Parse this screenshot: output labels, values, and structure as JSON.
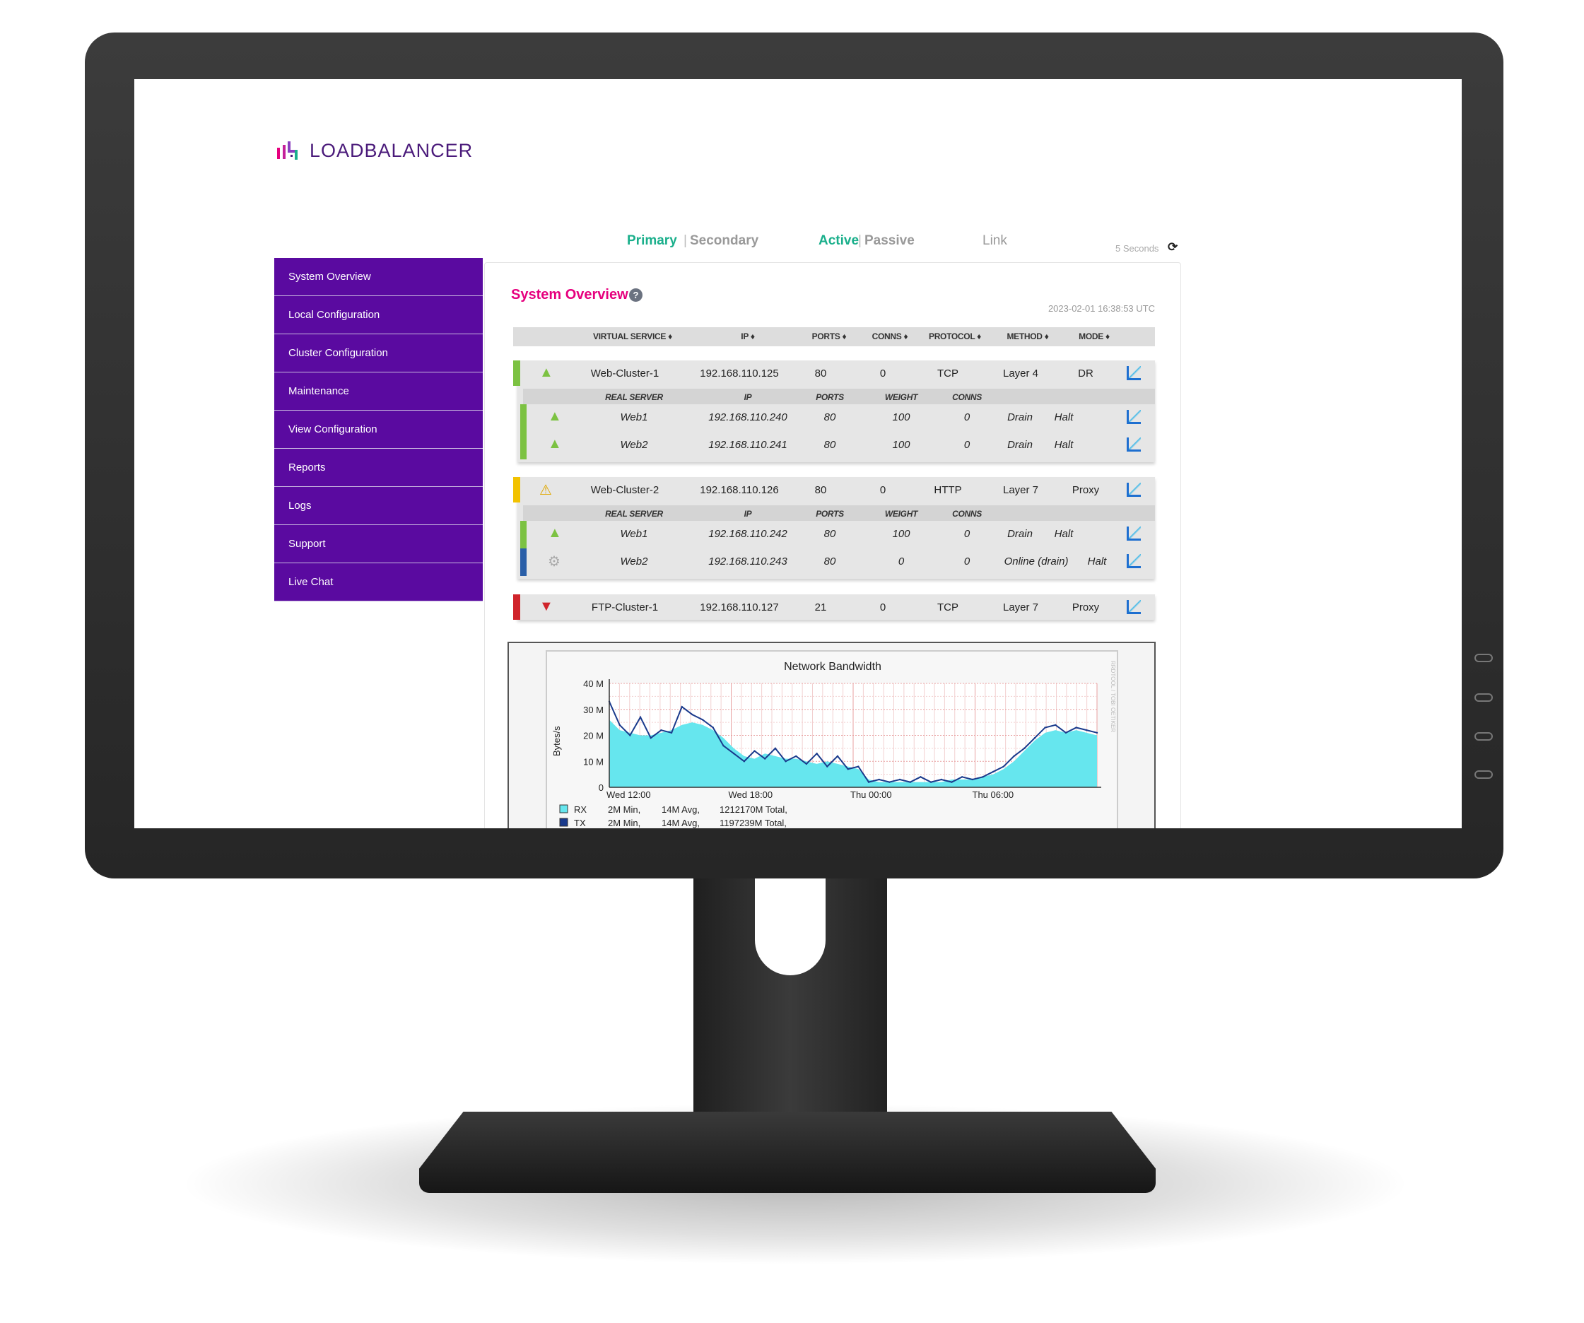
{
  "brand": {
    "name": "LOADBALANCER",
    "colors": {
      "primary": "#5a0aa0",
      "accent": "#e6007e",
      "teal": "#1aaf8b"
    }
  },
  "topnav": {
    "primary": "Primary",
    "secondary": "Secondary",
    "active": "Active",
    "passive": "Passive",
    "link": "Link",
    "refresh": "5 Seconds",
    "refresh_icon": "refresh-icon"
  },
  "sidebar": {
    "items": [
      {
        "label": "System Overview"
      },
      {
        "label": "Local Configuration"
      },
      {
        "label": "Cluster Configuration"
      },
      {
        "label": "Maintenance"
      },
      {
        "label": "View Configuration"
      },
      {
        "label": "Reports"
      },
      {
        "label": "Logs"
      },
      {
        "label": "Support"
      },
      {
        "label": "Live Chat"
      }
    ]
  },
  "main": {
    "title": "System Overview",
    "help_icon": "help-icon",
    "timestamp": "2023-02-01 16:38:53 UTC",
    "vs_headers": [
      "VIRTUAL SERVICE ♦",
      "IP ♦",
      "PORTS ♦",
      "CONNS ♦",
      "PROTOCOL ♦",
      "METHOD ♦",
      "MODE ♦"
    ],
    "rs_headers": [
      "REAL SERVER",
      "IP",
      "PORTS",
      "WEIGHT",
      "CONNS"
    ],
    "services": [
      {
        "name": "Web-Cluster-1",
        "ip": "192.168.110.125",
        "ports": "80",
        "conns": "0",
        "protocol": "TCP",
        "method": "Layer 4",
        "mode": "DR",
        "status": "up",
        "status_color": "#7cc242",
        "real_servers": [
          {
            "name": "Web1",
            "ip": "192.168.110.240",
            "ports": "80",
            "weight": "100",
            "conns": "0",
            "action1": "Drain",
            "action2": "Halt",
            "status": "up",
            "status_color": "#7cc242"
          },
          {
            "name": "Web2",
            "ip": "192.168.110.241",
            "ports": "80",
            "weight": "100",
            "conns": "0",
            "action1": "Drain",
            "action2": "Halt",
            "status": "up",
            "status_color": "#7cc242"
          }
        ]
      },
      {
        "name": "Web-Cluster-2",
        "ip": "192.168.110.126",
        "ports": "80",
        "conns": "0",
        "protocol": "HTTP",
        "method": "Layer 7",
        "mode": "Proxy",
        "status": "warning",
        "status_color": "#f2c200",
        "real_servers": [
          {
            "name": "Web1",
            "ip": "192.168.110.242",
            "ports": "80",
            "weight": "100",
            "conns": "0",
            "action1": "Drain",
            "action2": "Halt",
            "status": "up",
            "status_color": "#7cc242"
          },
          {
            "name": "Web2",
            "ip": "192.168.110.243",
            "ports": "80",
            "weight": "0",
            "conns": "0",
            "action1": "Online (drain)",
            "action2": "Halt",
            "status": "drain",
            "status_color": "#2a5fa8"
          }
        ]
      },
      {
        "name": "FTP-Cluster-1",
        "ip": "192.168.110.127",
        "ports": "21",
        "conns": "0",
        "protocol": "TCP",
        "method": "Layer 7",
        "mode": "Proxy",
        "status": "down",
        "status_color": "#d0242b",
        "real_servers": []
      }
    ]
  },
  "chart_data": {
    "type": "area",
    "title": "Network Bandwidth",
    "ylabel": "Bytes/s",
    "ylim": [
      0,
      40
    ],
    "yunit": "M",
    "yticks": [
      "0",
      "10 M",
      "20 M",
      "30 M",
      "40 M"
    ],
    "xticks": [
      "Wed 12:00",
      "Wed 18:00",
      "Thu 00:00",
      "Thu 06:00"
    ],
    "grid": true,
    "side_label": "RRDTOOL / TOBI OETIKER",
    "x": [
      "Wed 12:00",
      "Wed 12:30",
      "Wed 13:00",
      "Wed 13:30",
      "Wed 14:00",
      "Wed 14:30",
      "Wed 15:00",
      "Wed 15:30",
      "Wed 16:00",
      "Wed 16:30",
      "Wed 17:00",
      "Wed 17:30",
      "Wed 18:00",
      "Wed 18:30",
      "Wed 19:00",
      "Wed 19:30",
      "Wed 20:00",
      "Wed 20:30",
      "Wed 21:00",
      "Wed 21:30",
      "Wed 22:00",
      "Wed 22:30",
      "Wed 23:00",
      "Wed 23:30",
      "Thu 00:00",
      "Thu 00:30",
      "Thu 01:00",
      "Thu 01:30",
      "Thu 02:00",
      "Thu 02:30",
      "Thu 03:00",
      "Thu 03:30",
      "Thu 04:00",
      "Thu 04:30",
      "Thu 05:00",
      "Thu 05:30",
      "Thu 06:00",
      "Thu 06:30",
      "Thu 07:00",
      "Thu 07:30",
      "Thu 08:00",
      "Thu 08:30",
      "Thu 09:00",
      "Thu 09:30",
      "Thu 10:00",
      "Thu 10:30",
      "Thu 11:00",
      "Thu 11:30"
    ],
    "series": [
      {
        "name": "RX",
        "color": "#66e6ee",
        "values": [
          26,
          22,
          21,
          20,
          20,
          21,
          22,
          24,
          25,
          24,
          22,
          19,
          15,
          12,
          11,
          13,
          12,
          11,
          11,
          10,
          9,
          10,
          9,
          8,
          7,
          3,
          2,
          2,
          2,
          2,
          2,
          2,
          2,
          3,
          3,
          3,
          4,
          5,
          7,
          10,
          14,
          18,
          21,
          22,
          21,
          22,
          21,
          20
        ]
      },
      {
        "name": "TX",
        "color": "#1a3a8c",
        "values": [
          33,
          24,
          20,
          27,
          19,
          22,
          21,
          31,
          28,
          26,
          23,
          16,
          13,
          10,
          14,
          11,
          15,
          10,
          12,
          9,
          13,
          8,
          12,
          7,
          8,
          2,
          3,
          2,
          3,
          2,
          4,
          2,
          3,
          2,
          4,
          3,
          4,
          6,
          8,
          12,
          15,
          19,
          23,
          24,
          21,
          23,
          22,
          21
        ]
      }
    ],
    "legend": [
      {
        "name": "RX",
        "min": "2M Min,",
        "avg": "14M Avg,",
        "total": "1212170M Total,"
      },
      {
        "name": "TX",
        "min": "2M Min,",
        "avg": "14M Avg,",
        "total": "1197239M Total,"
      }
    ]
  }
}
